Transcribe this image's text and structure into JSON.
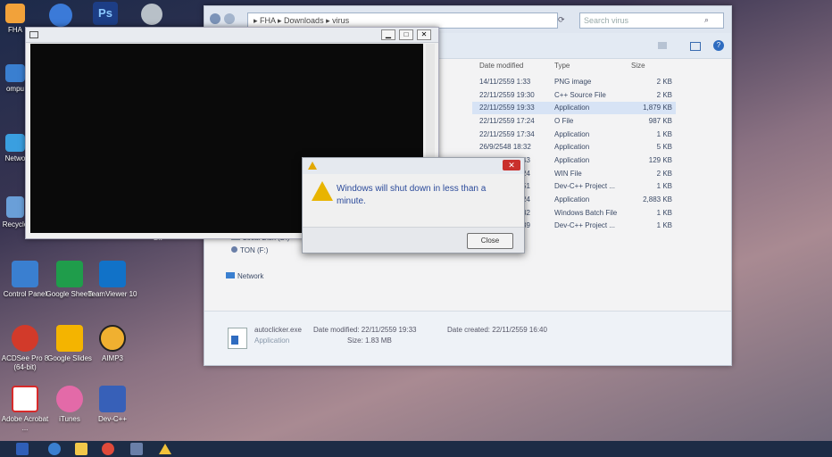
{
  "desktop": {
    "top_icons": [
      {
        "label": "FHA",
        "color": "#f2a23a"
      },
      {
        "label": "",
        "color": "#3b7ad8"
      },
      {
        "label": "Ps",
        "color": "#1d3e86"
      },
      {
        "label": "",
        "color": "#b8c0c8"
      }
    ],
    "left_icons": [
      {
        "label": "ompu",
        "color": "#3a7fd0"
      },
      {
        "label": "Netwo",
        "color": "#3a9fe0"
      },
      {
        "label": "Recycle",
        "color": "#6a9fd8"
      }
    ],
    "grid_icons": [
      {
        "label": "Control Panel",
        "color": "#3a7fd0"
      },
      {
        "label": "Google Sheets",
        "color": "#1f9d4b"
      },
      {
        "label": "TeamViewer 10",
        "color": "#1172c8"
      },
      {
        "label": "ACDSee Pro 8 (64-bit)",
        "color": "#d23a2a"
      },
      {
        "label": "Google Slides",
        "color": "#f4b400"
      },
      {
        "label": "AIMP3",
        "color": "#f0b030"
      },
      {
        "label": "Adobe Acrobat ...",
        "color": "#d82a2a"
      },
      {
        "label": "iTunes",
        "color": "#e36aa8"
      },
      {
        "label": "Dev-C++",
        "color": "#3760b8"
      }
    ],
    "stray_label": "Bit"
  },
  "explorer": {
    "breadcrumb": "▸ FHA ▸ Downloads ▸ virus",
    "search_placeholder": "Search virus",
    "columns": {
      "date": "Date modified",
      "type": "Type",
      "size": "Size"
    },
    "rows": [
      {
        "date": "14/11/2559 1:33",
        "type": "PNG image",
        "size": "2 KB"
      },
      {
        "date": "22/11/2559 19:30",
        "type": "C++ Source File",
        "size": "2 KB"
      },
      {
        "date": "22/11/2559 19:33",
        "type": "Application",
        "size": "1,879 KB"
      },
      {
        "date": "22/11/2559 17:24",
        "type": "O File",
        "size": "987 KB"
      },
      {
        "date": "22/11/2559 17:34",
        "type": "Application",
        "size": "1 KB"
      },
      {
        "date": "26/9/2548 18:32",
        "type": "Application",
        "size": "5 KB"
      },
      {
        "date": "43",
        "type": "Application",
        "size": "129 KB"
      },
      {
        "date": "24",
        "type": "WIN File",
        "size": "2 KB"
      },
      {
        "date": "51",
        "type": "Dev-C++ Project ...",
        "size": "1 KB"
      },
      {
        "date": "24",
        "type": "Application",
        "size": "2,883 KB"
      },
      {
        "date": "32",
        "type": "Windows Batch File",
        "size": "1 KB"
      },
      {
        "date": "39",
        "type": "Dev-C++ Project ...",
        "size": "1 KB"
      }
    ],
    "nav": {
      "local_disk": "Local Disk (D:)",
      "ton": "TON (F:)",
      "network": "Network"
    },
    "details": {
      "filename": "autoclicker.exe",
      "modified_label": "Date modified: 22/11/2559 19:33",
      "created_label": "Date created: 22/11/2559 16:40",
      "type": "Application",
      "size": "Size: 1.83 MB"
    }
  },
  "console": {
    "buttons": {
      "min": "▁",
      "max": "□",
      "close": "✕"
    }
  },
  "dialog": {
    "message": "Windows will shut down in less than a minute.",
    "close_label": "Close",
    "close_x": "✕"
  },
  "taskbar": {
    "items": [
      {
        "color": "#2f5fb8"
      },
      {
        "color": "#3a7fd0"
      },
      {
        "color": "#f2c84a"
      },
      {
        "color": "#e04a3a"
      },
      {
        "color": "#6a7fa8"
      },
      {
        "color": "#f2c23a"
      }
    ]
  }
}
